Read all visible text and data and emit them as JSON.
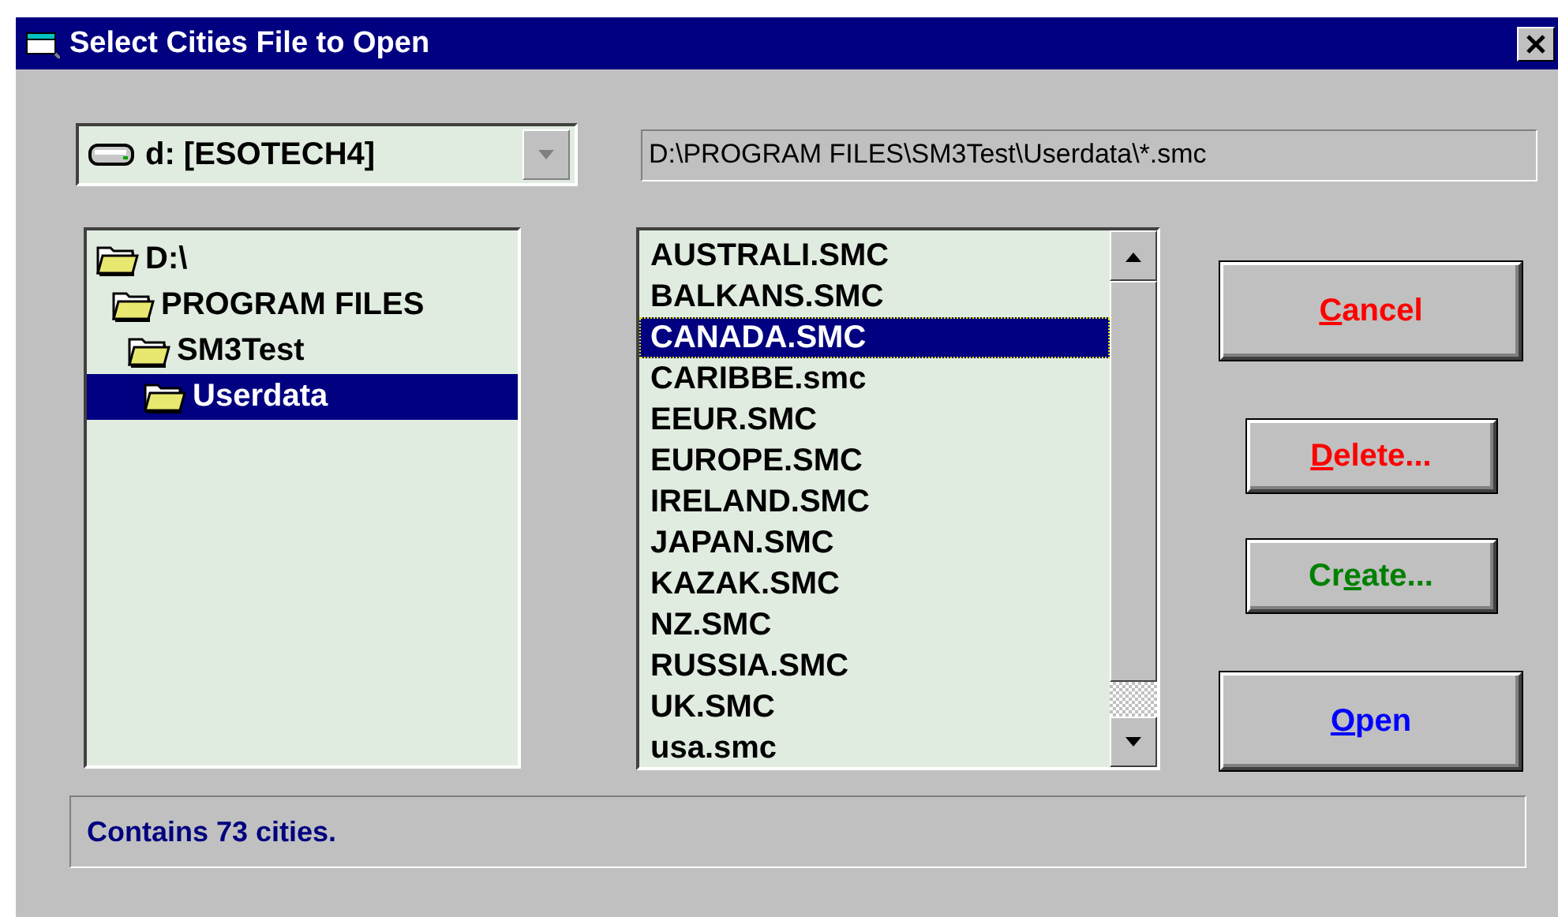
{
  "window": {
    "title": "Select Cities File to Open"
  },
  "drive": {
    "value": "d: [ESOTECH4]"
  },
  "path": {
    "value": "D:\\PROGRAM FILES\\SM3Test\\Userdata\\*.smc"
  },
  "folders": [
    {
      "label": "D:\\",
      "selected": false,
      "children": [
        {
          "label": "PROGRAM FILES",
          "selected": false,
          "children": [
            {
              "label": "SM3Test",
              "selected": false,
              "children": [
                {
                  "label": "Userdata",
                  "selected": true
                }
              ]
            }
          ]
        }
      ]
    }
  ],
  "files": [
    {
      "label": "AUSTRALI.SMC",
      "selected": false
    },
    {
      "label": "BALKANS.SMC",
      "selected": false
    },
    {
      "label": "CANADA.SMC",
      "selected": true
    },
    {
      "label": "CARIBBE.smc",
      "selected": false
    },
    {
      "label": "EEUR.SMC",
      "selected": false
    },
    {
      "label": "EUROPE.SMC",
      "selected": false
    },
    {
      "label": "IRELAND.SMC",
      "selected": false
    },
    {
      "label": "JAPAN.SMC",
      "selected": false
    },
    {
      "label": "KAZAK.SMC",
      "selected": false
    },
    {
      "label": "NZ.SMC",
      "selected": false
    },
    {
      "label": "RUSSIA.SMC",
      "selected": false
    },
    {
      "label": "UK.SMC",
      "selected": false
    },
    {
      "label": "usa.smc",
      "selected": false
    }
  ],
  "buttons": [
    {
      "key": "C",
      "post": "ancel",
      "color": "#ff0000",
      "kind": "large"
    },
    {
      "key": "D",
      "post": "elete...",
      "color": "#ff0000",
      "kind": "small"
    },
    {
      "pre": "Cr",
      "key": "e",
      "post": "ate...",
      "color": "#008000",
      "kind": "small"
    },
    {
      "key": "O",
      "post": "pen",
      "color": "#0000ff",
      "kind": "large"
    }
  ],
  "status": "Contains 73 cities."
}
